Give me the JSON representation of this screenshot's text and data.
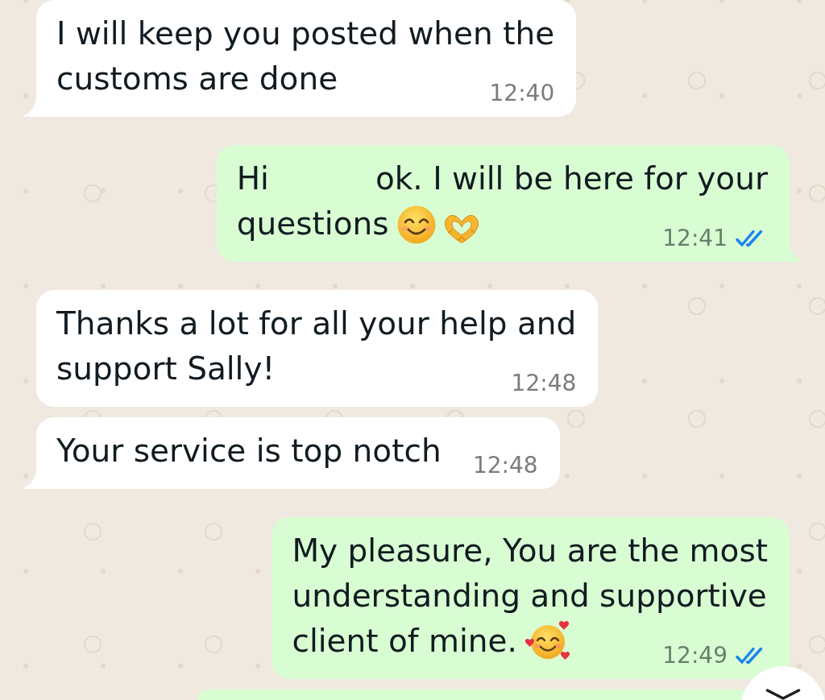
{
  "chat": {
    "messages": [
      {
        "kind": "incoming",
        "lines": [
          [
            "I will keep you posted when the"
          ],
          [
            "customs are done"
          ]
        ],
        "time": "12:40",
        "tail": true
      },
      {
        "kind": "outgoing",
        "lines": [
          [
            "Hi",
            "ok. I will be here for your"
          ],
          [
            "questions"
          ]
        ],
        "emoji": [
          {
            "kind": "smiling_face"
          },
          {
            "kind": "heart_hands"
          }
        ],
        "time": "12:41",
        "read": true,
        "tail": true
      },
      {
        "kind": "incoming",
        "lines": [
          [
            "Thanks a lot for all your help and"
          ],
          [
            "support Sally!"
          ]
        ],
        "time": "12:48",
        "tail": false
      },
      {
        "kind": "incoming",
        "lines": [
          [
            "Your service is top notch"
          ]
        ],
        "time": "12:48",
        "tail": true
      },
      {
        "kind": "outgoing",
        "lines": [
          [
            "My pleasure, You are the most"
          ],
          [
            "understanding and supportive"
          ],
          [
            "client of mine."
          ]
        ],
        "emoji": [
          {
            "kind": "smiling_face_with_hearts"
          }
        ],
        "time": "12:49",
        "read": true,
        "tail": false
      },
      {
        "kind": "outgoing",
        "cut_off": true
      }
    ]
  },
  "scroll_down_button": {
    "shown": true
  }
}
